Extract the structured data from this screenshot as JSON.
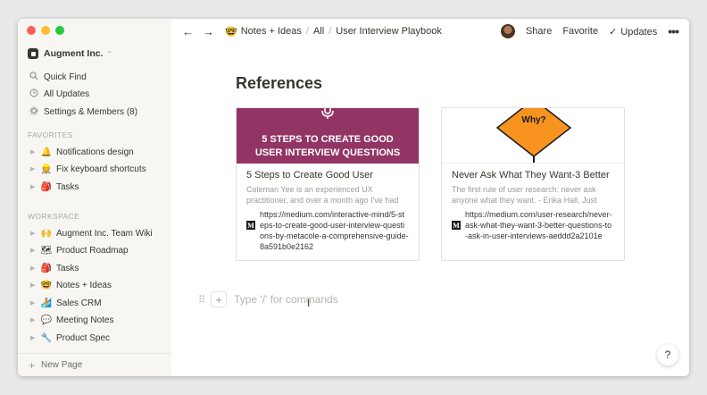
{
  "sidebar": {
    "workspace_name": "Augment Inc.",
    "workspace_chevron": "⌃",
    "nav": [
      {
        "label": "Quick Find",
        "icon": "search-icon"
      },
      {
        "label": "All Updates",
        "icon": "clock-icon"
      },
      {
        "label": "Settings & Members (8)",
        "icon": "gear-icon"
      }
    ],
    "favorites_label": "FAVORITES",
    "favorites": [
      {
        "emoji": "🔔",
        "label": "Notifications design"
      },
      {
        "emoji": "👷",
        "label": "Fix keyboard shortcuts"
      },
      {
        "emoji": "🎒",
        "label": "Tasks"
      }
    ],
    "workspace_label": "WORKSPACE",
    "workspace": [
      {
        "emoji": "🙌",
        "label": "Augment Inc. Team Wiki"
      },
      {
        "emoji": "🗺",
        "label": "Product Roadmap"
      },
      {
        "emoji": "🎒",
        "label": "Tasks"
      },
      {
        "emoji": "🤓",
        "label": "Notes + Ideas"
      },
      {
        "emoji": "🏄",
        "label": "Sales CRM"
      },
      {
        "emoji": "💬",
        "label": "Meeting Notes"
      },
      {
        "emoji": "🔧",
        "label": "Product Spec"
      }
    ],
    "new_page": "New Page"
  },
  "topbar": {
    "back": "←",
    "forward": "→",
    "crumbs": {
      "c1_emoji": "🤓",
      "c1": "Notes + Ideas",
      "sep": "/",
      "c2": "All",
      "c3": "User Interview Playbook"
    },
    "share": "Share",
    "favorite": "Favorite",
    "updates_check": "✓",
    "updates": "Updates",
    "more": "•••"
  },
  "page": {
    "heading": "References",
    "cards": [
      {
        "image_text_line1": "5 STEPS TO CREATE GOOD",
        "image_text_line2": "USER INTERVIEW QUESTIONS",
        "title": "5 Steps to Create Good User",
        "description": "Coleman Yee is an experienced UX practitioner, and over a month ago I've had",
        "link": "https://medium.com/interactive-mind/5-steps-to-create-good-user-interview-questions-by-metacole-a-comprehensive-guide-8a591b0e2162"
      },
      {
        "image_sign_text": "Why?",
        "title": "Never Ask What They Want-3 Better",
        "description": "The first rule of user research: never ask anyone what they want. - Erika Hall, Just",
        "link": "https://medium.com/user-research/never-ask-what-they-want-3-better-questions-to-ask-in-user-interviews-aeddd2a2101e"
      }
    ],
    "placeholder": "Type '/' for commands",
    "add_symbol": "+",
    "drag_handle": "⠿",
    "help": "?",
    "medium_letter": "M"
  },
  "colors": {
    "sidebar_bg": "#f7f6f3",
    "card1_image_bg": "#923564",
    "why_sign": "#f7931e",
    "text": "#37352f"
  }
}
